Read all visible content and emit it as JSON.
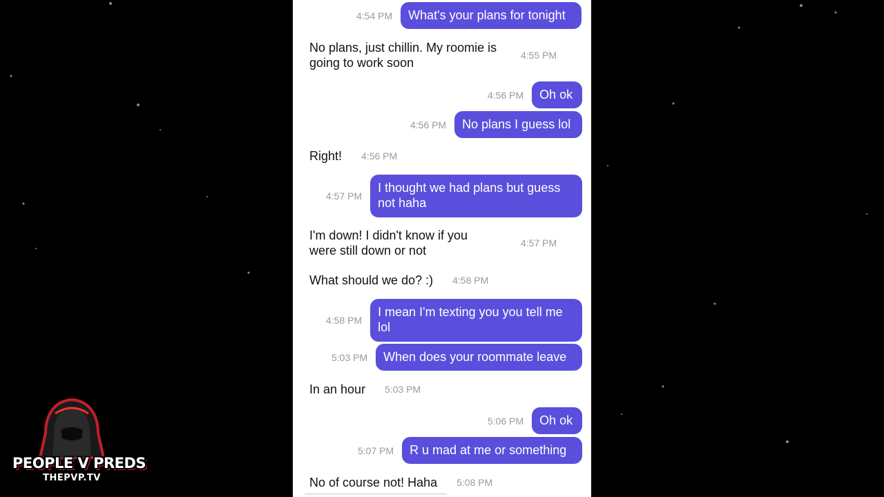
{
  "messages": [
    {
      "side": "sent",
      "text": "What's your plans for tonight",
      "time": "4:54 PM"
    },
    {
      "side": "received",
      "text": "No plans, just chillin. My roomie is going to work soon",
      "time": "4:55 PM"
    },
    {
      "side": "sent",
      "text": "Oh ok",
      "time": "4:56 PM"
    },
    {
      "side": "sent",
      "text": "No plans I guess lol",
      "time": "4:56 PM"
    },
    {
      "side": "received",
      "text": "Right!",
      "time": "4:56 PM"
    },
    {
      "side": "sent",
      "text": "I thought we had plans but guess not haha",
      "time": "4:57 PM"
    },
    {
      "side": "received",
      "text": "I'm down! I didn't know if you were still down or not",
      "time": "4:57 PM"
    },
    {
      "side": "received",
      "text": "What should we do? :)",
      "time": "4:58 PM"
    },
    {
      "side": "sent",
      "text": "I mean I'm texting you you tell me lol",
      "time": "4:58 PM"
    },
    {
      "side": "sent",
      "text": "When does your roommate leave",
      "time": "5:03 PM"
    },
    {
      "side": "received",
      "text": "In an hour",
      "time": "5:03 PM"
    },
    {
      "side": "sent",
      "text": "Oh ok",
      "time": "5:06 PM"
    },
    {
      "side": "sent",
      "text": "R u mad at me or something",
      "time": "5:07 PM"
    },
    {
      "side": "received",
      "text": "No of course not! Haha",
      "time": "5:08 PM"
    }
  ],
  "logo": {
    "title": "PEOPLE V PREDS",
    "subtitle": "THEPVP.TV"
  },
  "colors": {
    "sent_bubble": "#5a4fdc",
    "timestamp": "#9a9a9a",
    "background": "#000000",
    "panel": "#ffffff"
  }
}
